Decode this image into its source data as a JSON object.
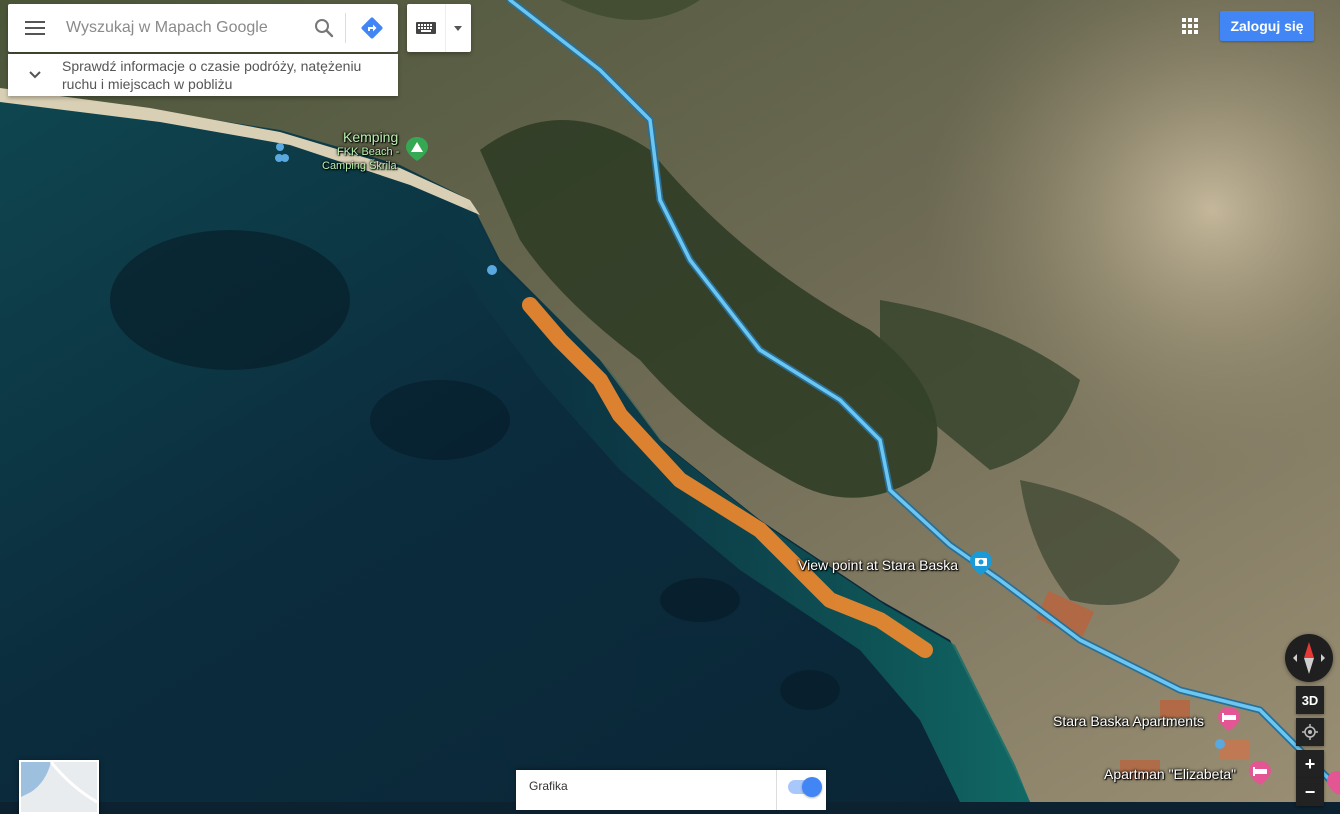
{
  "search": {
    "placeholder": "Wyszukaj w Mapach Google"
  },
  "info_panel": {
    "text": "Sprawdź informacje o czasie podróży, natężeniu ruchu i miejscach w pobliżu"
  },
  "header": {
    "signin_label": "Zaloguj się"
  },
  "map_labels": {
    "kemping": "Kemping",
    "fkk_line1": "FKK Beach -",
    "fkk_line2": "Camping Škrila",
    "view_point": "View point at Stara Baska",
    "stara_baska_apartments": "Stara Baska Apartments",
    "apartman_elizabeta": "Apartman \"Elizabeta\""
  },
  "controls": {
    "tilt_label": "3D",
    "zoom_in": "+",
    "zoom_out": "−"
  },
  "layers_panel": {
    "label": "Grafika",
    "toggle_on": true
  },
  "colors": {
    "accent": "#4285f4",
    "route_highlight": "#f28a2e",
    "road": "#5fb3e8",
    "camping_pin": "#34a853",
    "hotel_pin": "#e45593",
    "viewpoint_pin": "#1a9ad6"
  },
  "icons": {
    "menu": "menu-icon",
    "search": "search-icon",
    "directions": "directions-icon",
    "keyboard": "keyboard-icon",
    "apps": "apps-grid-icon",
    "compass": "compass-icon",
    "location": "my-location-icon"
  }
}
